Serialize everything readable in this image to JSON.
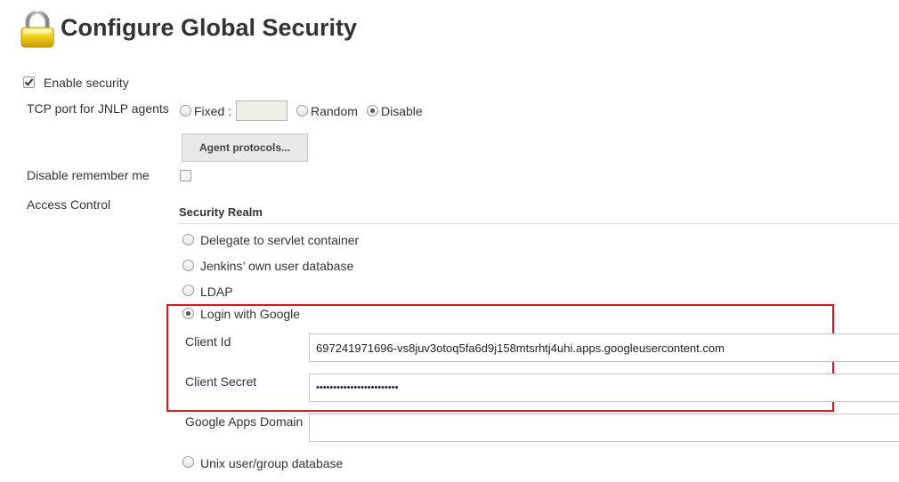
{
  "page": {
    "title": "Configure Global Security"
  },
  "enable_security": {
    "label": "Enable security",
    "checked": true
  },
  "tcp_port": {
    "label": "TCP port for JNLP agents",
    "options": [
      {
        "label": "Fixed :",
        "checked": false
      },
      {
        "label": "Random",
        "checked": false
      },
      {
        "label": "Disable",
        "checked": true
      }
    ],
    "fixed_value": ""
  },
  "agent_protocols_button": "Agent protocols...",
  "disable_remember_me": {
    "label": "Disable remember me",
    "checked": false
  },
  "access_control": {
    "label": "Access Control",
    "security_realm": {
      "heading": "Security Realm",
      "options": [
        {
          "label": "Delegate to servlet container",
          "checked": false
        },
        {
          "label": "Jenkins’ own user database",
          "checked": false
        },
        {
          "label": "LDAP",
          "checked": false
        },
        {
          "label": "Login with Google",
          "checked": true
        },
        {
          "label": "Unix user/group database",
          "checked": false
        }
      ],
      "google": {
        "client_id_label": "Client Id",
        "client_id_value": "697241971696-vs8juv3otoq5fa6d9j158mtsrhtj4uhi.apps.googleusercontent.com",
        "client_secret_label": "Client Secret",
        "client_secret_value": "••••••••••••••••••••••••",
        "apps_domain_label": "Google Apps Domain",
        "apps_domain_value": ""
      }
    }
  },
  "colors": {
    "highlight": "#e0141b",
    "lock_body": "#f2cf1a",
    "text": "#333333"
  },
  "icons": {
    "page": "lock-icon"
  }
}
